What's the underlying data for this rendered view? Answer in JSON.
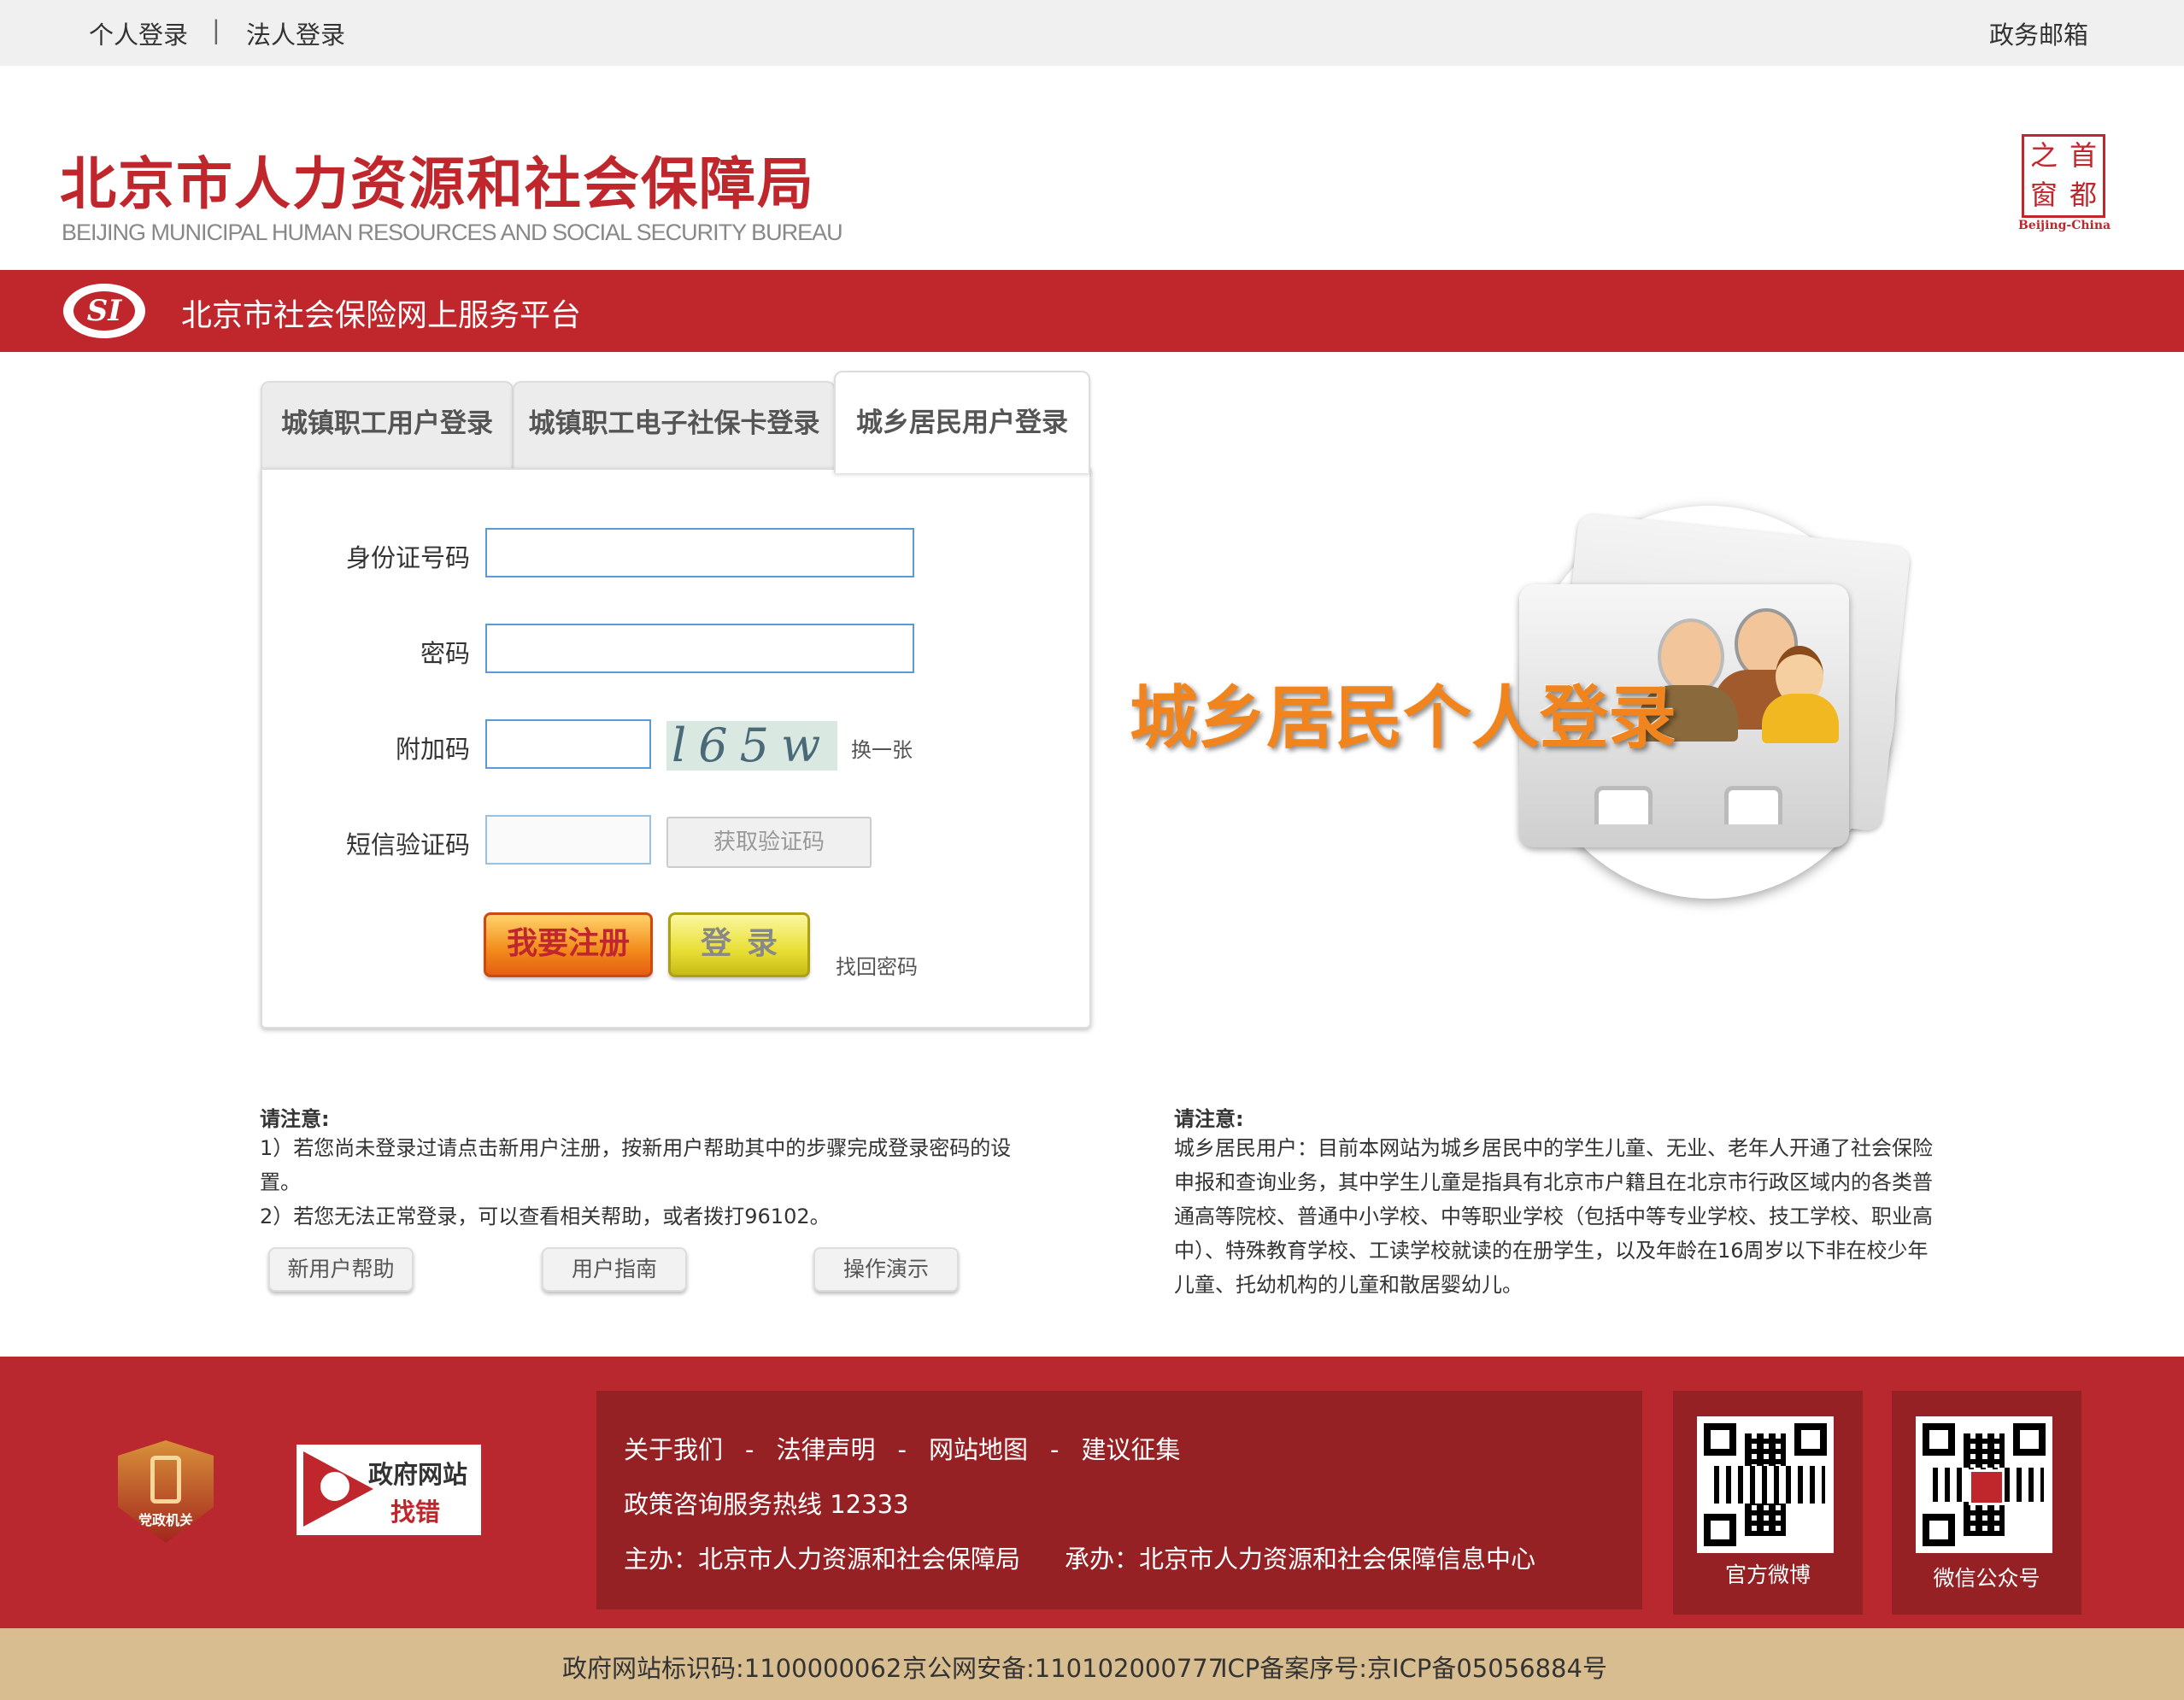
{
  "topbar": {
    "personal_login": "个人登录",
    "divider": "|",
    "corp_login": "法人登录",
    "gov_mail": "政务邮箱"
  },
  "header": {
    "title_cn": "北京市人力资源和社会保障局",
    "title_en": "BEIJING MUNICIPAL HUMAN RESOURCES AND SOCIAL SECURITY BUREAU",
    "seal_chars": [
      "之",
      "首",
      "窗",
      "都"
    ],
    "seal_caption": "Beijing-China"
  },
  "band": {
    "logo_text": "SI",
    "title": "北京市社会保险网上服务平台"
  },
  "tabs": [
    {
      "label": "城镇职工用户登录"
    },
    {
      "label": "城镇职工电子社保卡登录"
    },
    {
      "label": "城乡居民用户登录",
      "active": true
    }
  ],
  "form": {
    "id_label": "身份证号码",
    "id_value": "",
    "password_label": "密码",
    "password_value": "",
    "captcha_label": "附加码",
    "captcha_value": "",
    "captcha_image_text": "l65w",
    "captcha_refresh": "换一张",
    "sms_label": "短信验证码",
    "sms_value": "",
    "get_code_button": "获取验证码",
    "register_button": "我要注册",
    "login_button": "登录",
    "forgot_password": "找回密码"
  },
  "illustration": {
    "text": "城乡居民个人登录"
  },
  "notice_left": {
    "heading": "请注意:",
    "lines": [
      "1）若您尚未登录过请点击新用户注册，按新用户帮助其中的步骤完成登录密码的设",
      "置。",
      "2）若您无法正常登录，可以查看相关帮助，或者拨打96102。"
    ],
    "buttons": [
      "新用户帮助",
      "用户指南",
      "操作演示"
    ]
  },
  "notice_right": {
    "heading": "请注意:",
    "lines": [
      "城乡居民用户：目前本网站为城乡居民中的学生儿童、无业、老年人开通了社会保险",
      "申报和查询业务，其中学生儿童是指具有北京市户籍且在北京市行政区域内的各类普",
      "通高等院校、普通中小学校、中等职业学校（包括中等专业学校、技工学校、职业高",
      "中）、特殊教育学校、工读学校就读的在册学生，以及年龄在16周岁以下非在校少年",
      "儿童、托幼机构的儿童和散居婴幼儿。"
    ]
  },
  "footer": {
    "party_badge_text": "党政机关",
    "gov_find_line1": "政府网站",
    "gov_find_line2": "找错",
    "links": [
      "关于我们",
      "法律声明",
      "网站地图",
      "建议征集"
    ],
    "link_sep": "-",
    "hotline": "政策咨询服务热线 12333",
    "host_label": "主办：北京市人力资源和社会保障局",
    "organizer_label": "承办：北京市人力资源和社会保障信息中心",
    "weibo_caption": "官方微博",
    "wechat_caption": "微信公众号"
  },
  "bottom": {
    "site_id": "政府网站标识码:1100000062",
    "police_record": "京公网安备:110102000777",
    "icp": "ICP备案序号:京ICP备05056884号"
  },
  "colors": {
    "brand_red": "#c0272d",
    "dark_red": "#962125",
    "footer_red": "#b8282e",
    "bottom_tan": "#d8bd90",
    "input_border": "#5b9bd5",
    "illustration_orange": "#f0851f"
  }
}
